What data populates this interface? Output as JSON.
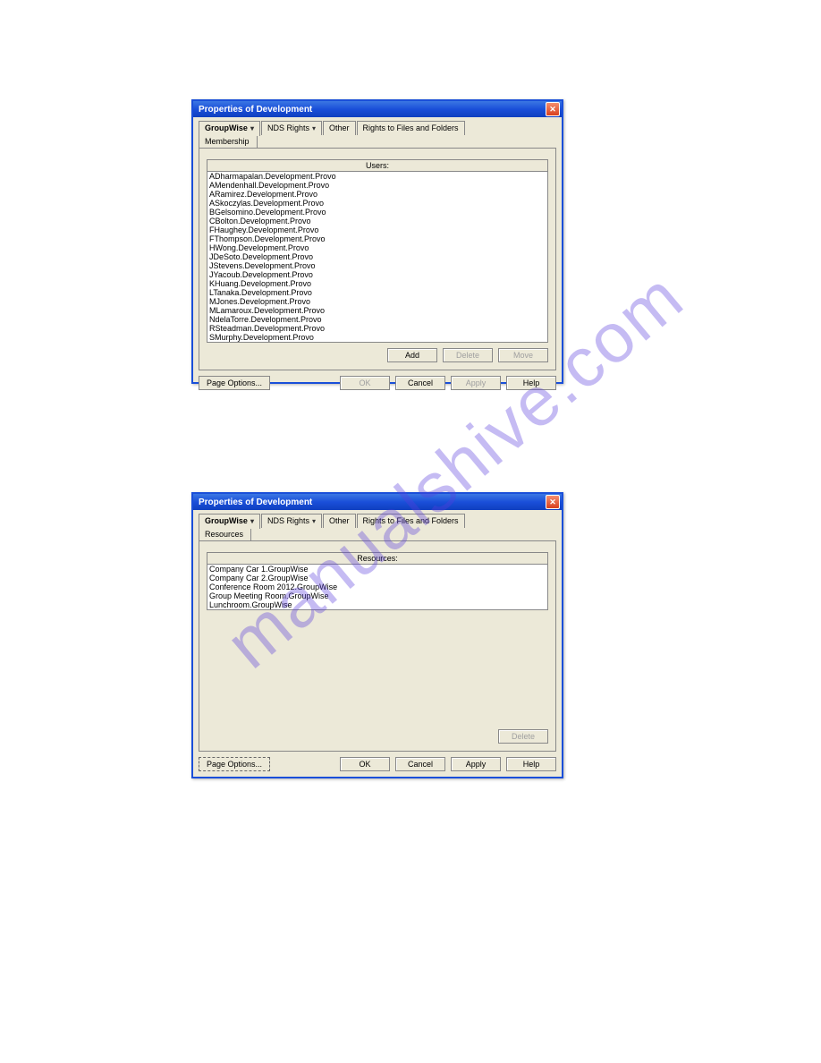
{
  "watermark": "manualshive.com",
  "dialog1": {
    "title": "Properties of Development",
    "tabs": {
      "groupwise": "GroupWise",
      "nds": "NDS Rights",
      "other": "Other",
      "rights": "Rights to Files and Folders"
    },
    "subtab": "Membership",
    "list_header": "Users:",
    "users": [
      "ADharmapalan.Development.Provo",
      "AMendenhall.Development.Provo",
      "ARamirez.Development.Provo",
      "ASkoczylas.Development.Provo",
      "BGelsomino.Development.Provo",
      "CBolton.Development.Provo",
      "FHaughey.Development.Provo",
      "FThompson.Development.Provo",
      "HWong.Development.Provo",
      "JDeSoto.Development.Provo",
      "JStevens.Development.Provo",
      "JYacoub.Development.Provo",
      "KHuang.Development.Provo",
      "LTanaka.Development.Provo",
      "MJones.Development.Provo",
      "MLamaroux.Development.Provo",
      "NdelaTorre.Development.Provo",
      "RSteadman.Development.Provo",
      "SMurphy.Development.Provo"
    ],
    "inner_buttons": {
      "add": "Add",
      "delete": "Delete",
      "move": "Move"
    },
    "footer": {
      "page_options": "Page Options...",
      "ok": "OK",
      "cancel": "Cancel",
      "apply": "Apply",
      "help": "Help"
    }
  },
  "dialog2": {
    "title": "Properties of Development",
    "tabs": {
      "groupwise": "GroupWise",
      "nds": "NDS Rights",
      "other": "Other",
      "rights": "Rights to Files and Folders"
    },
    "subtab": "Resources",
    "list_header": "Resources:",
    "resources": [
      "Company Car 1.GroupWise",
      "Company Car 2.GroupWise",
      "Conference Room 2012.GroupWise",
      "Group Meeting Room.GroupWise",
      "Lunchroom.GroupWise"
    ],
    "inner_buttons": {
      "delete": "Delete"
    },
    "footer": {
      "page_options": "Page Options...",
      "ok": "OK",
      "cancel": "Cancel",
      "apply": "Apply",
      "help": "Help"
    }
  }
}
